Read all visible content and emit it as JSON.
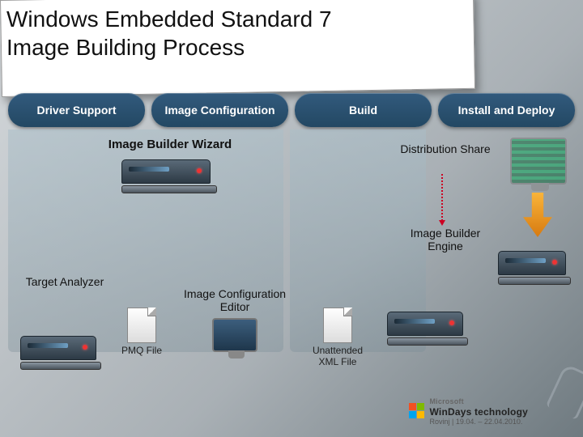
{
  "title_line1": "Windows Embedded Standard 7",
  "title_line2": "Image Building Process",
  "stages": {
    "driver": "Driver Support",
    "config": "Image Configuration",
    "build": "Build",
    "install": "Install and Deploy"
  },
  "nodes": {
    "wizard": "Image Builder Wizard",
    "distribution": "Distribution Share",
    "engine": "Image Builder Engine",
    "target_analyzer": "Target Analyzer",
    "ice": "Image Configuration Editor",
    "pmq_file": "PMQ File",
    "xml_file": "Unattended XML File"
  },
  "footer": {
    "brand": "Microsoft",
    "product": "WinDays technology",
    "dateloc": "Rovinj | 19.04. – 22.04.2010."
  },
  "colors": {
    "stage_bg_top": "#325a7d",
    "stage_bg_bottom": "#234863",
    "arrow": "#f9b43a"
  }
}
